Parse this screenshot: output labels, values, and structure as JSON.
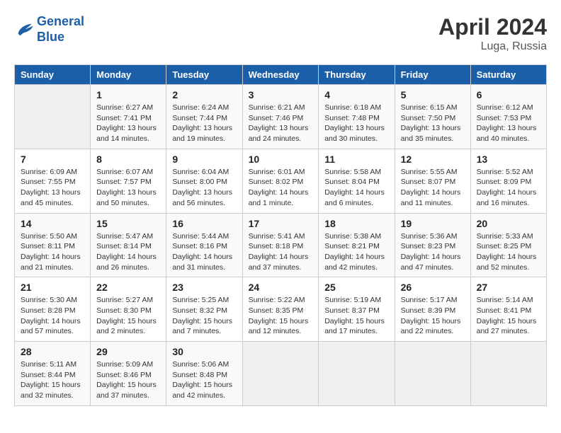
{
  "logo": {
    "line1": "General",
    "line2": "Blue"
  },
  "title": "April 2024",
  "subtitle": "Luga, Russia",
  "columns": [
    "Sunday",
    "Monday",
    "Tuesday",
    "Wednesday",
    "Thursday",
    "Friday",
    "Saturday"
  ],
  "weeks": [
    [
      {
        "day": "",
        "info": ""
      },
      {
        "day": "1",
        "info": "Sunrise: 6:27 AM\nSunset: 7:41 PM\nDaylight: 13 hours\nand 14 minutes."
      },
      {
        "day": "2",
        "info": "Sunrise: 6:24 AM\nSunset: 7:44 PM\nDaylight: 13 hours\nand 19 minutes."
      },
      {
        "day": "3",
        "info": "Sunrise: 6:21 AM\nSunset: 7:46 PM\nDaylight: 13 hours\nand 24 minutes."
      },
      {
        "day": "4",
        "info": "Sunrise: 6:18 AM\nSunset: 7:48 PM\nDaylight: 13 hours\nand 30 minutes."
      },
      {
        "day": "5",
        "info": "Sunrise: 6:15 AM\nSunset: 7:50 PM\nDaylight: 13 hours\nand 35 minutes."
      },
      {
        "day": "6",
        "info": "Sunrise: 6:12 AM\nSunset: 7:53 PM\nDaylight: 13 hours\nand 40 minutes."
      }
    ],
    [
      {
        "day": "7",
        "info": "Sunrise: 6:09 AM\nSunset: 7:55 PM\nDaylight: 13 hours\nand 45 minutes."
      },
      {
        "day": "8",
        "info": "Sunrise: 6:07 AM\nSunset: 7:57 PM\nDaylight: 13 hours\nand 50 minutes."
      },
      {
        "day": "9",
        "info": "Sunrise: 6:04 AM\nSunset: 8:00 PM\nDaylight: 13 hours\nand 56 minutes."
      },
      {
        "day": "10",
        "info": "Sunrise: 6:01 AM\nSunset: 8:02 PM\nDaylight: 14 hours\nand 1 minute."
      },
      {
        "day": "11",
        "info": "Sunrise: 5:58 AM\nSunset: 8:04 PM\nDaylight: 14 hours\nand 6 minutes."
      },
      {
        "day": "12",
        "info": "Sunrise: 5:55 AM\nSunset: 8:07 PM\nDaylight: 14 hours\nand 11 minutes."
      },
      {
        "day": "13",
        "info": "Sunrise: 5:52 AM\nSunset: 8:09 PM\nDaylight: 14 hours\nand 16 minutes."
      }
    ],
    [
      {
        "day": "14",
        "info": "Sunrise: 5:50 AM\nSunset: 8:11 PM\nDaylight: 14 hours\nand 21 minutes."
      },
      {
        "day": "15",
        "info": "Sunrise: 5:47 AM\nSunset: 8:14 PM\nDaylight: 14 hours\nand 26 minutes."
      },
      {
        "day": "16",
        "info": "Sunrise: 5:44 AM\nSunset: 8:16 PM\nDaylight: 14 hours\nand 31 minutes."
      },
      {
        "day": "17",
        "info": "Sunrise: 5:41 AM\nSunset: 8:18 PM\nDaylight: 14 hours\nand 37 minutes."
      },
      {
        "day": "18",
        "info": "Sunrise: 5:38 AM\nSunset: 8:21 PM\nDaylight: 14 hours\nand 42 minutes."
      },
      {
        "day": "19",
        "info": "Sunrise: 5:36 AM\nSunset: 8:23 PM\nDaylight: 14 hours\nand 47 minutes."
      },
      {
        "day": "20",
        "info": "Sunrise: 5:33 AM\nSunset: 8:25 PM\nDaylight: 14 hours\nand 52 minutes."
      }
    ],
    [
      {
        "day": "21",
        "info": "Sunrise: 5:30 AM\nSunset: 8:28 PM\nDaylight: 14 hours\nand 57 minutes."
      },
      {
        "day": "22",
        "info": "Sunrise: 5:27 AM\nSunset: 8:30 PM\nDaylight: 15 hours\nand 2 minutes."
      },
      {
        "day": "23",
        "info": "Sunrise: 5:25 AM\nSunset: 8:32 PM\nDaylight: 15 hours\nand 7 minutes."
      },
      {
        "day": "24",
        "info": "Sunrise: 5:22 AM\nSunset: 8:35 PM\nDaylight: 15 hours\nand 12 minutes."
      },
      {
        "day": "25",
        "info": "Sunrise: 5:19 AM\nSunset: 8:37 PM\nDaylight: 15 hours\nand 17 minutes."
      },
      {
        "day": "26",
        "info": "Sunrise: 5:17 AM\nSunset: 8:39 PM\nDaylight: 15 hours\nand 22 minutes."
      },
      {
        "day": "27",
        "info": "Sunrise: 5:14 AM\nSunset: 8:41 PM\nDaylight: 15 hours\nand 27 minutes."
      }
    ],
    [
      {
        "day": "28",
        "info": "Sunrise: 5:11 AM\nSunset: 8:44 PM\nDaylight: 15 hours\nand 32 minutes."
      },
      {
        "day": "29",
        "info": "Sunrise: 5:09 AM\nSunset: 8:46 PM\nDaylight: 15 hours\nand 37 minutes."
      },
      {
        "day": "30",
        "info": "Sunrise: 5:06 AM\nSunset: 8:48 PM\nDaylight: 15 hours\nand 42 minutes."
      },
      {
        "day": "",
        "info": ""
      },
      {
        "day": "",
        "info": ""
      },
      {
        "day": "",
        "info": ""
      },
      {
        "day": "",
        "info": ""
      }
    ]
  ]
}
